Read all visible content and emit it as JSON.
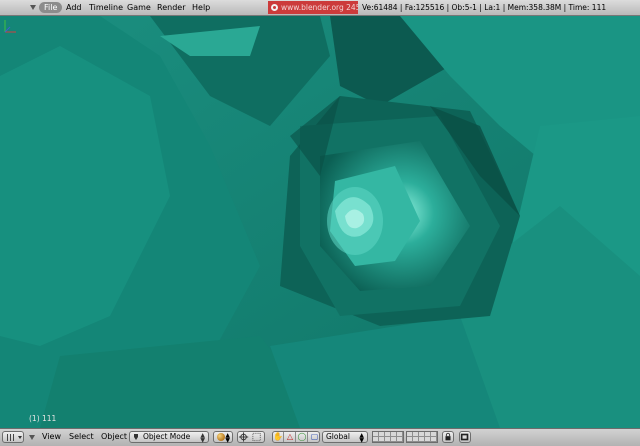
{
  "menubar": {
    "items": [
      "File",
      "Add",
      "Timeline",
      "Game",
      "Render",
      "Help"
    ],
    "engine_label": "www.blender.org 245",
    "stats": "Ve:61484 | Fa:125516 | Ob:5-1 | La:1  | Mem:358.38M  | Time: 111"
  },
  "viewport": {
    "frame_info": "(1) 111",
    "colors": {
      "base": "#137c6d",
      "light": "#2bb3a0",
      "dark": "#0a4f45"
    }
  },
  "header": {
    "menus": [
      "View",
      "Select",
      "Object"
    ],
    "mode": "Object Mode",
    "orientation": "Global"
  },
  "icons": {
    "editor_type": "grid-icon",
    "mode": "object-mode-icon",
    "shading": "solid-shading-icon",
    "pivot": "pivot-icon",
    "manipulators": [
      "hand-icon",
      "translate-icon",
      "rotate-icon",
      "scale-icon"
    ],
    "lock": "lock-icon",
    "render": "render-icon"
  }
}
